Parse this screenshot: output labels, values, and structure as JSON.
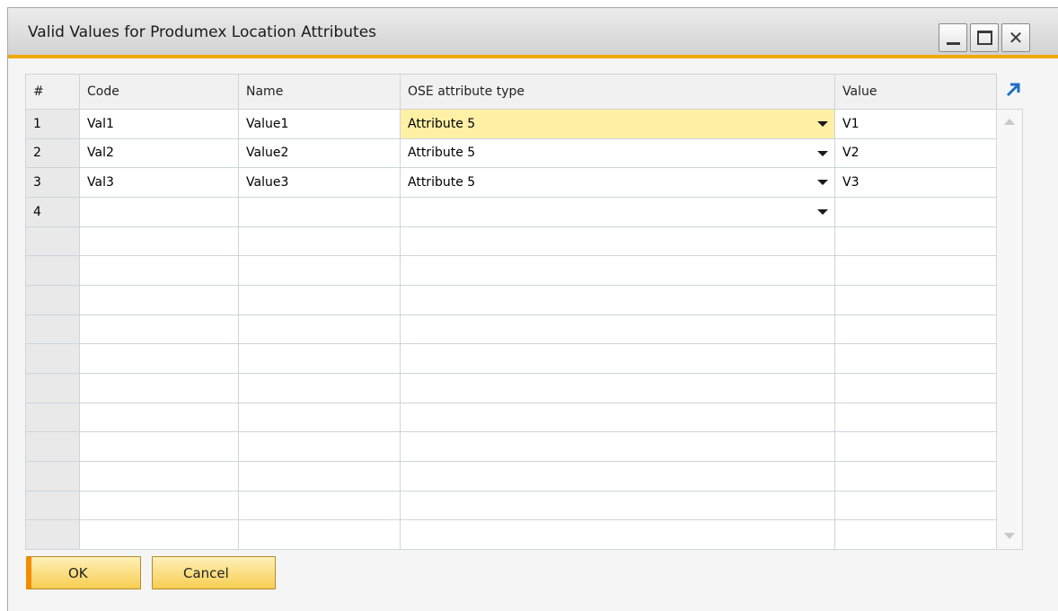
{
  "window": {
    "title": "Valid Values for Produmex Location Attributes"
  },
  "grid": {
    "columns": [
      "#",
      "Code",
      "Name",
      "OSE attribute type",
      "Value"
    ],
    "rows": [
      {
        "num": "1",
        "code": "Val1",
        "name": "Value1",
        "type": "Attribute 5",
        "value": "V1"
      },
      {
        "num": "2",
        "code": "Val2",
        "name": "Value2",
        "type": "Attribute 5",
        "value": "V2"
      },
      {
        "num": "3",
        "code": "Val3",
        "name": "Value3",
        "type": "Attribute 5",
        "value": "V3"
      },
      {
        "num": "4",
        "code": "",
        "name": "",
        "type": "",
        "value": ""
      }
    ],
    "empty_rows": 11,
    "highlight_color": "#fff0a5"
  },
  "buttons": {
    "ok": "OK",
    "cancel": "Cancel"
  },
  "colors": {
    "accent": "#f0ab00",
    "button": "#f7cd52"
  },
  "icons": {
    "minimize": "minimize-icon",
    "maximize": "maximize-icon",
    "close": "close-icon",
    "expand": "expand-arrow-icon",
    "dropdown": "chevron-down-icon"
  }
}
